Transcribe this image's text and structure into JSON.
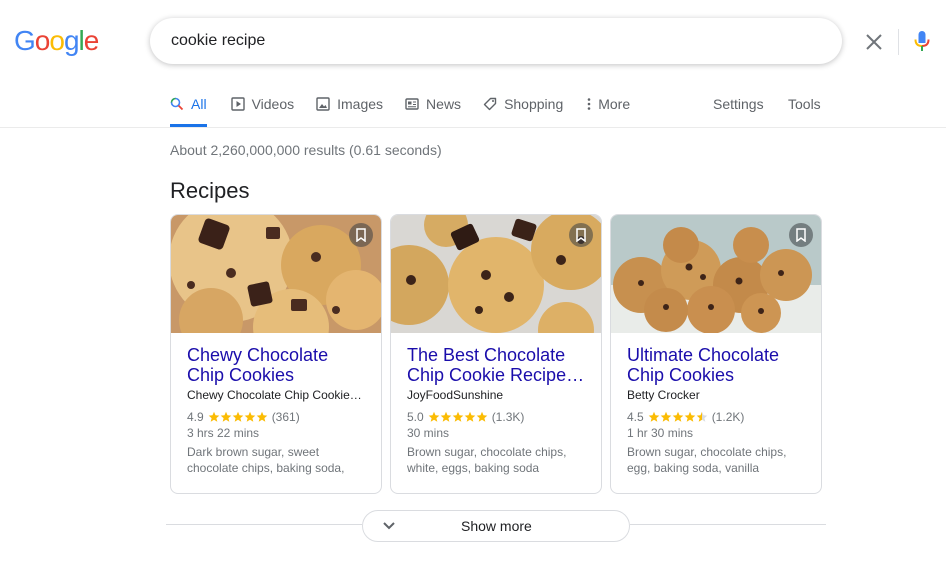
{
  "logo": {
    "letters": [
      "G",
      "o",
      "o",
      "g",
      "l",
      "e"
    ],
    "colors": [
      "#4285f4",
      "#ea4335",
      "#fbbc05",
      "#4285f4",
      "#34a853",
      "#ea4335"
    ]
  },
  "search": {
    "value": "cookie recipe",
    "clear_icon": "close-icon",
    "mic_icon": "mic-icon",
    "search_icon": "search-icon"
  },
  "tabs": [
    {
      "label": "All",
      "icon": "search-icon",
      "active": true
    },
    {
      "label": "Videos",
      "icon": "play-icon"
    },
    {
      "label": "Images",
      "icon": "image-icon"
    },
    {
      "label": "News",
      "icon": "news-icon"
    },
    {
      "label": "Shopping",
      "icon": "tag-icon"
    },
    {
      "label": "More",
      "icon": "more-vert-icon"
    }
  ],
  "tools": {
    "settings": "Settings",
    "tools": "Tools"
  },
  "result_stats": "About 2,260,000,000 results (0.61 seconds)",
  "section_title": "Recipes",
  "cards": [
    {
      "title": "Chewy Chocolate Chip Cookies",
      "source": "Chewy Chocolate Chip Cookie…",
      "rating": "4.9",
      "stars": 5,
      "reviews": "(361)",
      "time": "3 hrs 22 mins",
      "ingredients": "Dark brown sugar, sweet chocolate chips, baking soda,"
    },
    {
      "title": "The Best Chocolate Chip Cookie Recipe…",
      "source": "JoyFoodSunshine",
      "rating": "5.0",
      "stars": 5,
      "reviews": "(1.3K)",
      "time": "30 mins",
      "ingredients": "Brown sugar, chocolate chips, white, eggs, baking soda"
    },
    {
      "title": "Ultimate Chocolate Chip Cookies",
      "source": "Betty Crocker",
      "rating": "4.5",
      "stars": 4.5,
      "reviews": "(1.2K)",
      "time": "1 hr 30 mins",
      "ingredients": "Brown sugar, chocolate chips, egg, baking soda, vanilla"
    }
  ],
  "show_more": "Show more",
  "colors": {
    "link": "#1a0dab",
    "accent": "#1a73e8",
    "star": "#fbbc04",
    "muted": "#70757a"
  }
}
